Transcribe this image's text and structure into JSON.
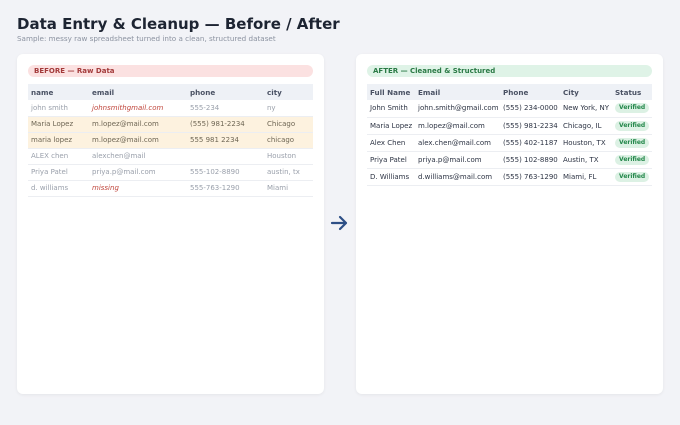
{
  "page": {
    "title": "Data Entry & Cleanup — Before / After",
    "subtitle": "Sample: messy raw spreadsheet turned into a clean, structured dataset"
  },
  "before": {
    "label": "BEFORE — Raw Data",
    "headers": [
      "name",
      "email",
      "phone",
      "city"
    ],
    "rows": [
      {
        "cells": [
          "john smith",
          "johnsmithgmail.com",
          "555-234",
          "ny"
        ],
        "error_cell": 1,
        "duplicate": false
      },
      {
        "cells": [
          "Maria Lopez",
          "m.lopez@mail.com",
          "(555) 981-2234",
          "Chicago"
        ],
        "error_cell": -1,
        "duplicate": true
      },
      {
        "cells": [
          "maria lopez",
          "m.lopez@mail.com",
          "555 981 2234",
          "chicago"
        ],
        "error_cell": -1,
        "duplicate": true
      },
      {
        "cells": [
          "ALEX chen",
          "alexchen@mail",
          "",
          "Houston"
        ],
        "error_cell": -1,
        "duplicate": false
      },
      {
        "cells": [
          "Priya Patel",
          "priya.p@mail.com",
          "555-102-8890",
          "austin, tx"
        ],
        "error_cell": -1,
        "duplicate": false
      },
      {
        "cells": [
          "d. williams",
          "missing",
          "555-763-1290",
          "Miami"
        ],
        "error_cell": 1,
        "duplicate": false
      }
    ]
  },
  "after": {
    "label": "AFTER — Cleaned & Structured",
    "headers": [
      "Full Name",
      "Email",
      "Phone",
      "City",
      "Status"
    ],
    "rows": [
      {
        "cells": [
          "John Smith",
          "john.smith@gmail.com",
          "(555) 234-0000",
          "New York, NY"
        ],
        "status": "Verified"
      },
      {
        "cells": [
          "Maria Lopez",
          "m.lopez@mail.com",
          "(555) 981-2234",
          "Chicago, IL"
        ],
        "status": "Verified"
      },
      {
        "cells": [
          "Alex Chen",
          "alex.chen@mail.com",
          "(555) 402-1187",
          "Houston, TX"
        ],
        "status": "Verified"
      },
      {
        "cells": [
          "Priya Patel",
          "priya.p@mail.com",
          "(555) 102-8890",
          "Austin, TX"
        ],
        "status": "Verified"
      },
      {
        "cells": [
          "D. Williams",
          "d.williams@mail.com",
          "(555) 763-1290",
          "Miami, FL"
        ],
        "status": "Verified"
      }
    ]
  },
  "icons": {
    "arrow": "arrow-right-icon"
  },
  "colors": {
    "arrow": "#2d4f86",
    "before_accent": "#a33a3a",
    "after_accent": "#2a7a45",
    "duplicate_highlight": "#fdf2df",
    "error_text": "#c0463c"
  }
}
